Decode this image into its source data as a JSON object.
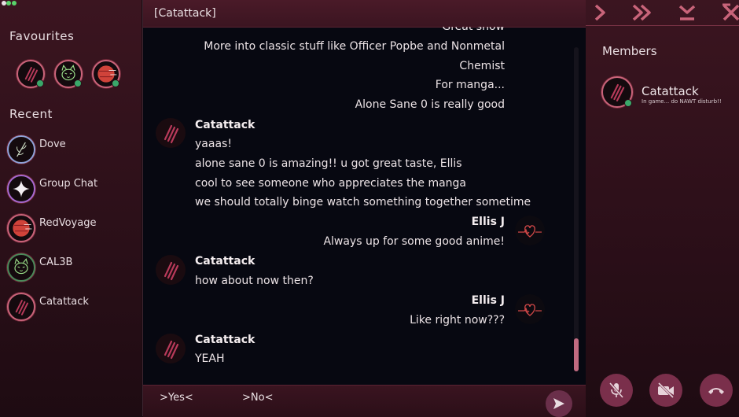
{
  "sidebar": {
    "favourites_title": "Favourites",
    "recent_title": "Recent",
    "recent": [
      {
        "label": "Dove",
        "icon": "leaf-icon"
      },
      {
        "label": "Group Chat",
        "icon": "sparkle-icon"
      },
      {
        "label": "RedVoyage",
        "icon": "red-planet-icon"
      },
      {
        "label": "CAL3B",
        "icon": "cat-face-icon"
      },
      {
        "label": "Catattack",
        "icon": "claw-marks-icon"
      }
    ],
    "favourites": [
      {
        "icon": "claw-marks-icon",
        "online": true
      },
      {
        "icon": "cat-face-icon",
        "online": true
      },
      {
        "icon": "red-planet-icon",
        "online": true
      }
    ]
  },
  "chat": {
    "title": "[Catattack]",
    "messages": {
      "partial_top": "Great show",
      "line1": "More into classic stuff like Officer Popbe and Nonmetal",
      "line2": "Chemist",
      "line3": "For manga...",
      "line4": "Alone Sane 0 is really good",
      "sender_a": "Catattack",
      "a1": "yaaas!",
      "a2": "alone sane 0 is amazing!! u got great taste, Ellis",
      "a3": "cool to see someone who appreciates the manga",
      "a4": "we should totally binge watch something together sometime",
      "sender_b": "Ellis J",
      "b1": "Always up for some good anime!",
      "sender_c": "Catattack",
      "c1": "how about now then?",
      "sender_d": "Ellis J",
      "d1": "Like right now???",
      "sender_e": "Catattack",
      "e1": "YEAH"
    },
    "choices": {
      "yes": ">Yes<",
      "no": ">No<"
    }
  },
  "members": {
    "title": "Members",
    "list": [
      {
        "name": "Catattack",
        "status": "In game... do NAWT disturb!!",
        "icon": "claw-marks-icon",
        "online": true
      }
    ]
  },
  "controls": [
    "next-icon",
    "fast-forward-icon",
    "skip-down-icon",
    "close-icon"
  ],
  "call_buttons": [
    "mic-muted-icon",
    "video-off-icon",
    "hang-up-icon"
  ],
  "colors": {
    "accent": "#c9647a",
    "online": "#3aa86a",
    "chat_bg": "#070811",
    "panel": "#3b1520",
    "button": "#7a2f4b",
    "claw": "#b83a5a",
    "cat": "#9be08a",
    "planet": "#d0433a"
  }
}
